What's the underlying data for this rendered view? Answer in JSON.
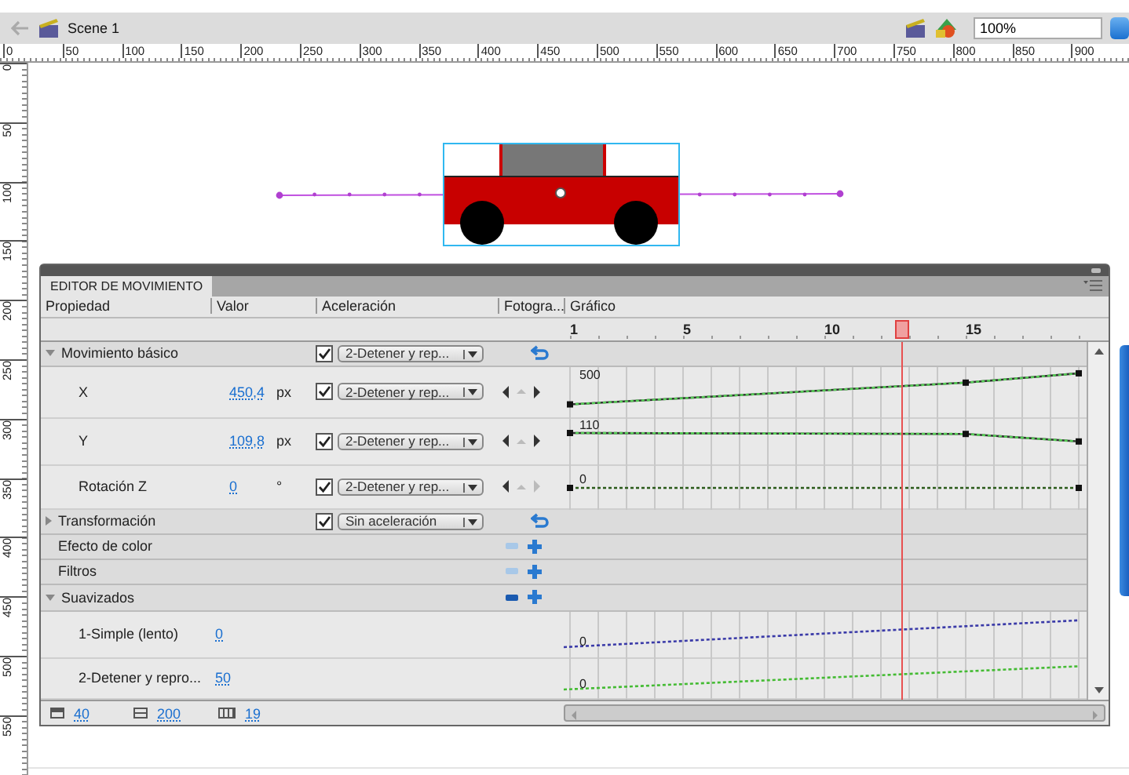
{
  "toolbar": {
    "scene": "Scene 1",
    "zoom": "100%"
  },
  "ruler": {
    "horizontal": [
      "0",
      "50",
      "100",
      "150",
      "200",
      "250",
      "300",
      "350",
      "400",
      "450",
      "500",
      "550",
      "600",
      "650",
      "700",
      "750",
      "800",
      "850",
      "900"
    ],
    "vertical": [
      "0",
      "50",
      "100",
      "150",
      "200",
      "250",
      "300",
      "350",
      "400",
      "450",
      "500",
      "550"
    ]
  },
  "motion_editor": {
    "tab": "EDITOR DE MOVIMIENTO",
    "columns": [
      "Propiedad",
      "Valor",
      "Aceleración",
      "Fotogra...",
      "Gráfico"
    ],
    "frame_labels": [
      "1",
      "5",
      "10",
      "15"
    ],
    "rows": [
      {
        "kind": "group",
        "label": "Movimiento básico",
        "expanded": true,
        "easing": {
          "checked": true,
          "value": "2-Detener y rep..."
        }
      },
      {
        "kind": "property",
        "label": "X",
        "value": "450,4",
        "unit": "px",
        "easing": {
          "checked": true,
          "value": "2-Detener y rep..."
        },
        "next_enabled": true,
        "graph_label": "500"
      },
      {
        "kind": "property",
        "label": "Y",
        "value": "109,8",
        "unit": "px",
        "easing": {
          "checked": true,
          "value": "2-Detener y rep..."
        },
        "next_enabled": true,
        "graph_label": "110"
      },
      {
        "kind": "property",
        "label": "Rotación Z",
        "value": "0",
        "unit": "°",
        "easing": {
          "checked": true,
          "value": "2-Detener y rep..."
        },
        "next_enabled": false,
        "graph_label": "0"
      },
      {
        "kind": "group",
        "label": "Transformación",
        "expanded": false,
        "easing": {
          "checked": true,
          "value": "Sin aceleración"
        }
      },
      {
        "kind": "group",
        "label": "Efecto de color",
        "remove_enabled": false
      },
      {
        "kind": "group",
        "label": "Filtros",
        "remove_enabled": false
      },
      {
        "kind": "group",
        "label": "Suavizados",
        "expanded": true,
        "remove_enabled": true
      },
      {
        "kind": "ease",
        "label": "1-Simple (lento)",
        "value": "0",
        "graph_label": "0",
        "color": "#3a3aa8"
      },
      {
        "kind": "ease",
        "label": "2-Detener y repro...",
        "value": "50",
        "graph_label": "0",
        "color": "#44bb33"
      }
    ],
    "footer": [
      "40",
      "200",
      "19"
    ]
  }
}
